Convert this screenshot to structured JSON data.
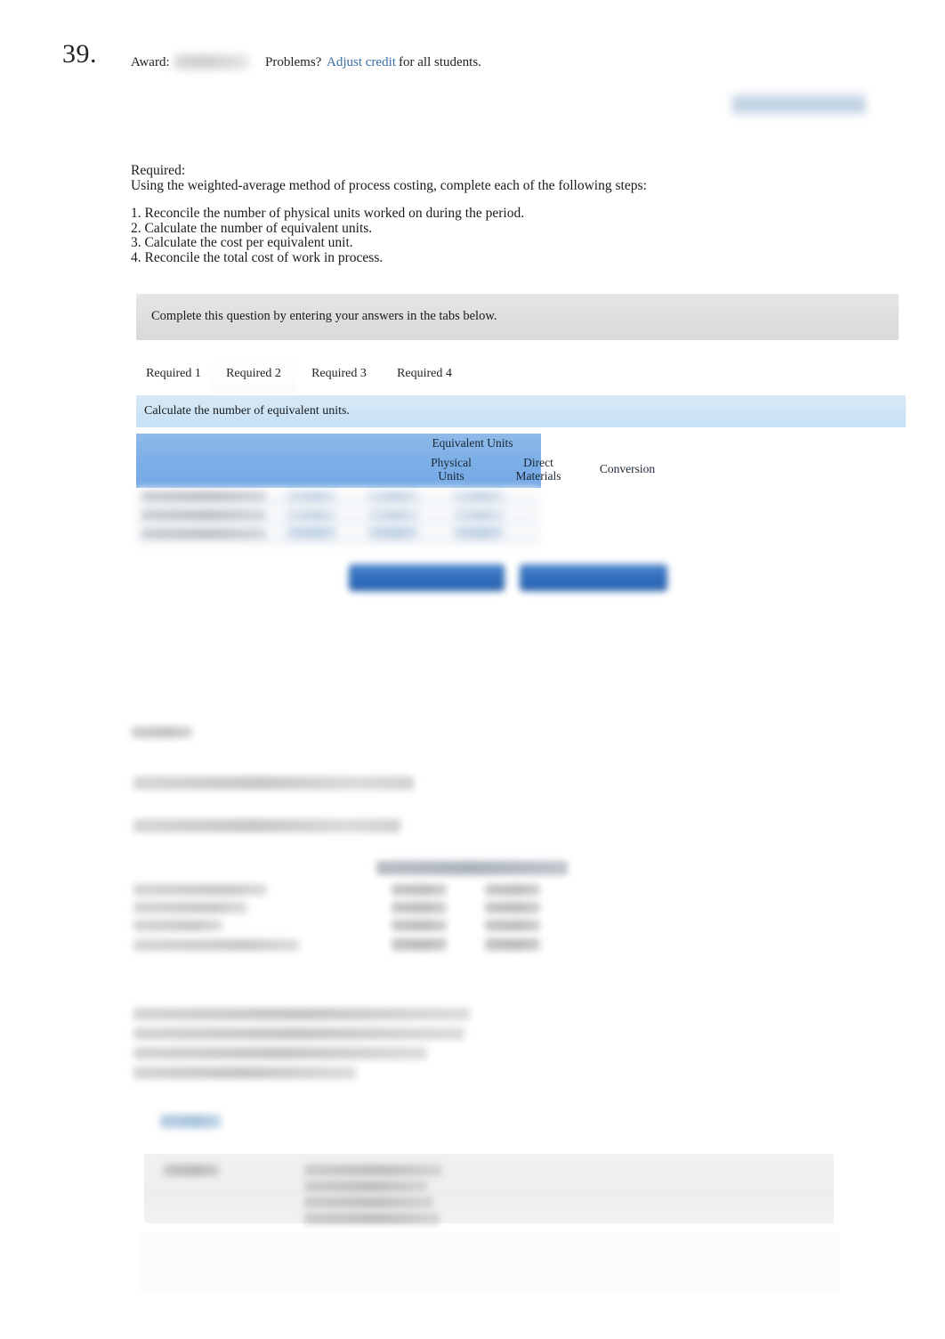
{
  "header": {
    "question_number": "39.",
    "award_label": "Award:",
    "award_value": "",
    "problems_label": "Problems?",
    "adjust_credit_link": "Adjust credit",
    "for_all_students": "for all students.",
    "header_button_label": ""
  },
  "required": {
    "heading": "Required:",
    "intro": "Using the weighted-average method of process costing, complete each of the following steps:",
    "steps": [
      "1. Reconcile the number of physical units worked on during the period.",
      "2. Calculate the number of equivalent units.",
      "3. Calculate the cost per equivalent unit.",
      "4. Reconcile the total cost of work in process."
    ]
  },
  "worksheet": {
    "complete_bar_text": "Complete this question by entering your answers in the tabs below.",
    "tabs": [
      {
        "label": "Required 1",
        "selected": false
      },
      {
        "label": "Required 2",
        "selected": true
      },
      {
        "label": "Required 3",
        "selected": false
      },
      {
        "label": "Required 4",
        "selected": false
      }
    ],
    "sub_instruction": "Calculate the number of equivalent units.",
    "table": {
      "group_header": "Equivalent Units",
      "columns": [
        "",
        "Physical\nUnits",
        "Direct\nMaterials",
        "Conversion"
      ],
      "column_physical": "Physical Units",
      "column_direct_materials": "Direct Materials",
      "column_conversion": "Conversion",
      "rows": [
        {
          "label": "",
          "physical_units": "",
          "direct_materials": "",
          "conversion": ""
        },
        {
          "label": "",
          "physical_units": "",
          "direct_materials": "",
          "conversion": ""
        },
        {
          "label": "",
          "physical_units": "",
          "direct_materials": "",
          "conversion": ""
        }
      ]
    },
    "nav_buttons": {
      "prev_label": "",
      "next_label": ""
    }
  },
  "explanation": {
    "title": "",
    "line1": "",
    "line2": "",
    "table_header": "",
    "table_rows": [
      {
        "label": "",
        "value1": "",
        "value2": ""
      },
      {
        "label": "",
        "value1": "",
        "value2": ""
      },
      {
        "label": "",
        "value1": "",
        "value2": ""
      },
      {
        "label": "",
        "value1": "",
        "value2": ""
      }
    ],
    "paragraph_lines": [
      "",
      "",
      "",
      ""
    ]
  },
  "references": {
    "link_label": ""
  },
  "metadata": {
    "key_label": "",
    "values": [
      "",
      "",
      "",
      ""
    ]
  },
  "colors": {
    "link_blue": "#3a6ea5",
    "table_header_blue": "#7eb0e8",
    "instruction_bar_blue": "#cde4f5",
    "complete_bar_gray": "#e0e0e0",
    "nav_button_blue": "#2f6cba"
  }
}
